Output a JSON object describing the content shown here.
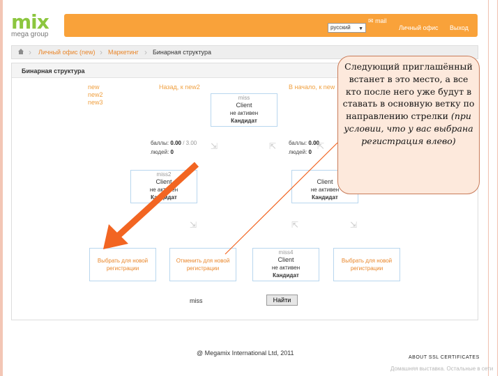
{
  "logo": {
    "brand": "mix",
    "sub": "mega group"
  },
  "header": {
    "language": "русский",
    "mail": "mail",
    "cabinet": "Личный офис",
    "logout": "Выход"
  },
  "breadcrumb": [
    "Личный офис (new)",
    "Маркетинг",
    "Бинарная структура"
  ],
  "panel": {
    "title": "Бинарная структура",
    "left_logins": [
      "new",
      "new2",
      "new3"
    ],
    "back_link": "Назад, к new2",
    "start_link": "В начало, к new",
    "stats_left": {
      "points_label": "баллы:",
      "points": "0.00",
      "of": "/ 3.00",
      "people_label": "людей:",
      "people": "0"
    },
    "stats_right": {
      "points_label": "баллы:",
      "points": "0.00",
      "people_label": "людей:",
      "people": "0"
    }
  },
  "cards": {
    "top": {
      "login": "miss",
      "name": "Client",
      "status": "не активен",
      "rank": "Кандидат"
    },
    "mid_left": {
      "login": "miss2",
      "name": "Client",
      "status": "не активен",
      "rank": "Кандидат"
    },
    "mid_right": {
      "name": "Client",
      "status": "не активен",
      "rank": "Кандидат"
    },
    "bottom": [
      {
        "text": "Выбрать для новой регистрации"
      },
      {
        "text": "Отменить для новой регистрации"
      },
      {
        "login": "miss4",
        "name": "Client",
        "status": "не активен",
        "rank": "Кандидат"
      },
      {
        "text": "Выбрать для новой регистрации"
      }
    ]
  },
  "search": {
    "value": "miss",
    "button": "Найти"
  },
  "footer": {
    "copyright": "@ Megamix International Ltd, 2011",
    "ssl": "ABOUT SSL CERTIFICATES",
    "watermark": "Домашняя выставка. Остальные в сети"
  },
  "callout": {
    "text": "Следующий приглашённый встанет в это место, а все кто после него уже будут в ставать в основную ветку по направлению стрелки",
    "italic": "(при условии, что у вас выбрана регистрация влево)"
  },
  "colors": {
    "topbar": "#f9a23a",
    "link": "#e9862a",
    "accent_arrow": "#f26522",
    "card_border": "#b8d6ee",
    "callout_bg": "#fde9dc"
  }
}
